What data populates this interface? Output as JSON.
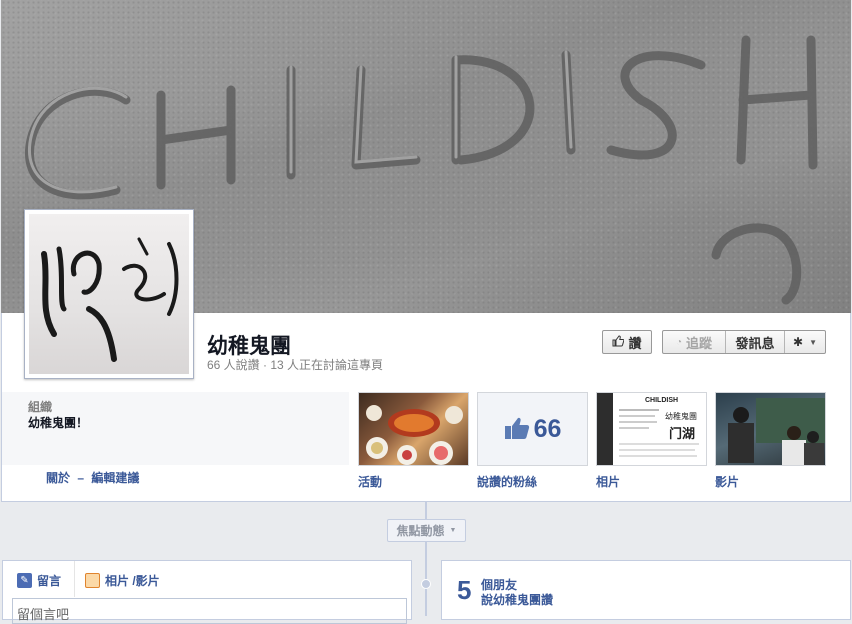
{
  "cover": {
    "text": "CHILDISH"
  },
  "page": {
    "name": "幼稚鬼團",
    "stats": "66 人說讚 · 13 人正在討論這專頁"
  },
  "actions": {
    "like": "讚",
    "follow": "追蹤",
    "message": "發訊息",
    "gear_icon": "gear-icon"
  },
  "about": {
    "category": "組織",
    "description": "幼稚鬼團！",
    "link_about": "關於",
    "link_separator": "–",
    "link_suggest": "編輯建議"
  },
  "apps": [
    {
      "label": "活動"
    },
    {
      "label": "說讚的粉絲",
      "value": "66"
    },
    {
      "label": "相片",
      "thumb_title": "CHILDISH",
      "thumb_text": "幼稚鬼團"
    },
    {
      "label": "影片"
    }
  ],
  "timeline": {
    "highlights": "焦點動態"
  },
  "composer": {
    "tab_post": "留言",
    "tab_photo": "相片 /影片",
    "placeholder": "留個言吧"
  },
  "friends": {
    "count": "5",
    "line1": "個朋友",
    "line2": "說幼稚鬼團讚"
  },
  "colors": {
    "link": "#3b5998",
    "page_bg": "#e9ebee",
    "border": "#c4cde0"
  }
}
